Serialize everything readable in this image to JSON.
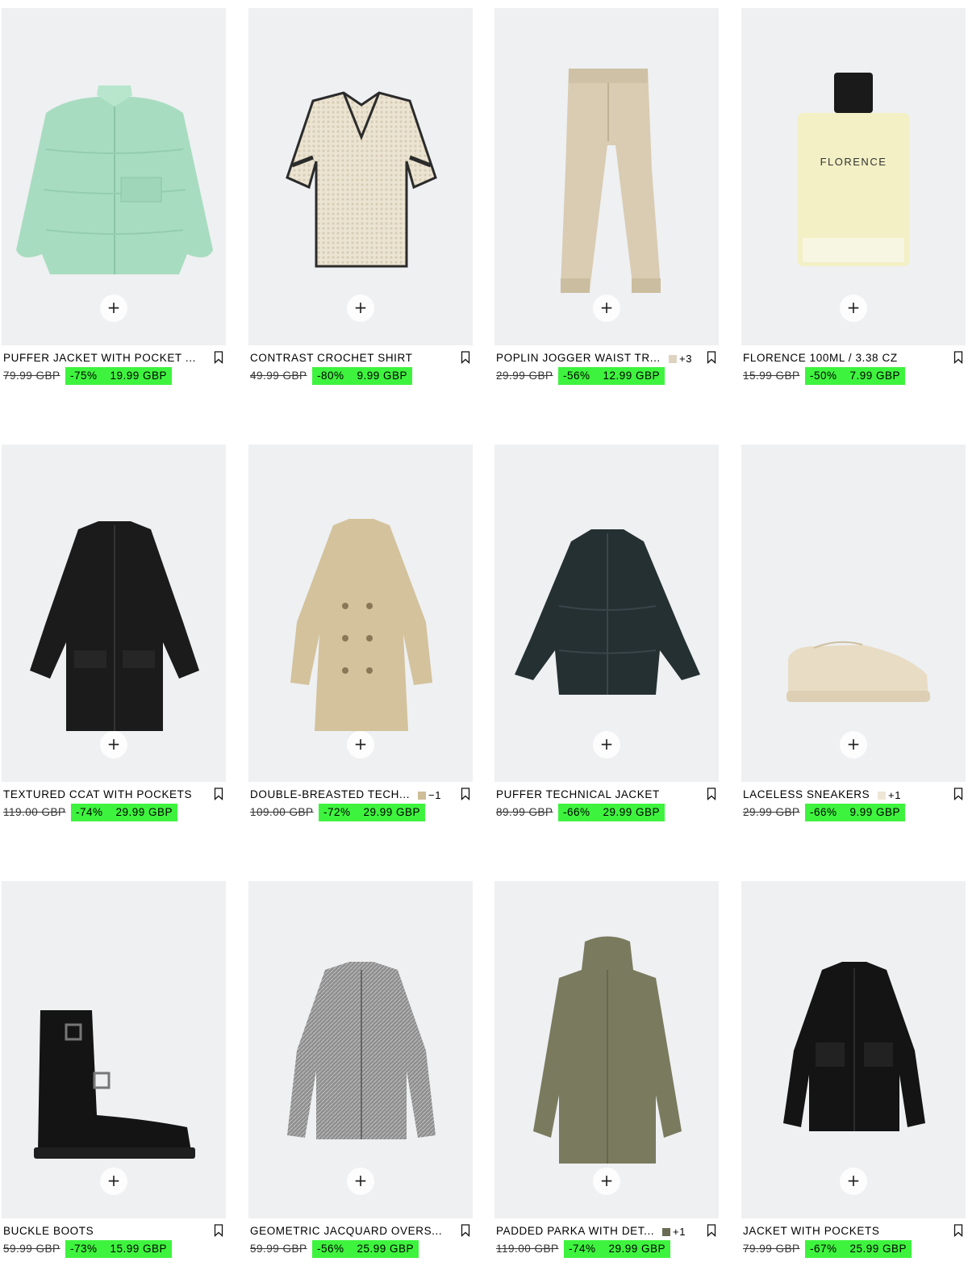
{
  "accent_color": "#3ef33e",
  "add_label": "+",
  "products": [
    {
      "name": "PUFFER JACKET WITH POCKET ...",
      "old_price": "79.99 GBP",
      "discount": "-75%",
      "price": "19.99 GBP",
      "extra_colors": "",
      "swatch_color": "",
      "image": "puffer-jacket-mint"
    },
    {
      "name": "CONTRAST CROCHET SHIRT",
      "old_price": "49.99 GBP",
      "discount": "-80%",
      "price": "9.99 GBP",
      "extra_colors": "",
      "swatch_color": "",
      "image": "crochet-shirt"
    },
    {
      "name": "POPLIN JOGGER WAIST TR...",
      "old_price": "29.99 GBP",
      "discount": "-56%",
      "price": "12.99 GBP",
      "extra_colors": "+3",
      "swatch_color": "#ddd3c0",
      "image": "jogger-trousers-beige"
    },
    {
      "name": "FLORENCE 100ML / 3.38 CZ",
      "old_price": "15.99 GBP",
      "discount": "-50%",
      "price": "7.99 GBP",
      "extra_colors": "",
      "swatch_color": "",
      "image": "florence-perfume"
    },
    {
      "name": "TEXTURED CCAT WITH POCKETS",
      "old_price": "119.00 GBP",
      "discount": "-74%",
      "price": "29.99 GBP",
      "extra_colors": "",
      "swatch_color": "",
      "image": "coat-black"
    },
    {
      "name": "DOUBLE-BREASTED TECH...",
      "old_price": "109.00 GBP",
      "discount": "-72%",
      "price": "29.99 GBP",
      "extra_colors": "−1",
      "swatch_color": "#cdbd98",
      "image": "trench-coat-beige"
    },
    {
      "name": "PUFFER TECHNICAL JACKET",
      "old_price": "89.99 GBP",
      "discount": "-66%",
      "price": "29.99 GBP",
      "extra_colors": "",
      "swatch_color": "",
      "image": "puffer-jacket-dark"
    },
    {
      "name": "LACELESS SNEAKERS",
      "old_price": "29.99 GBP",
      "discount": "-66%",
      "price": "9.99 GBP",
      "extra_colors": "+1",
      "swatch_color": "#efe6d6",
      "image": "sneakers-cream"
    },
    {
      "name": "BUCKLE BOOTS",
      "old_price": "59.99 GBP",
      "discount": "-73%",
      "price": "15.99 GBP",
      "extra_colors": "",
      "swatch_color": "",
      "image": "buckle-boots-black"
    },
    {
      "name": "GEOMETRIC JACQUARD OVERS...",
      "old_price": "59.99 GBP",
      "discount": "-56%",
      "price": "25.99 GBP",
      "extra_colors": "",
      "swatch_color": "",
      "image": "jacquard-overshirt-grey"
    },
    {
      "name": "PADDED PARKA WITH DET...",
      "old_price": "119.00 GBP",
      "discount": "-74%",
      "price": "29.99 GBP",
      "extra_colors": "+1",
      "swatch_color": "#6b6a55",
      "image": "parka-khaki"
    },
    {
      "name": "JACKET WITH POCKETS",
      "old_price": "79.99 GBP",
      "discount": "-67%",
      "price": "25.99 GBP",
      "extra_colors": "",
      "swatch_color": "",
      "image": "jacket-black"
    }
  ]
}
